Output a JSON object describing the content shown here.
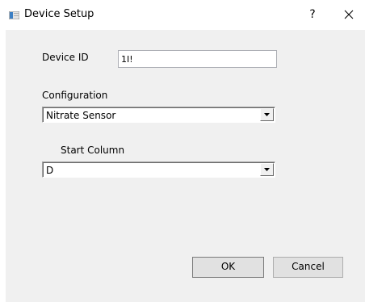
{
  "window": {
    "title": "Device Setup",
    "help_glyph": "?",
    "close_glyph": "×",
    "app_icon": "window-icon"
  },
  "form": {
    "device_id": {
      "label": "Device ID",
      "value": "1I!"
    },
    "configuration": {
      "label": "Configuration",
      "selected": "Nitrate Sensor"
    },
    "start_column": {
      "label": "Start Column",
      "selected": "D"
    }
  },
  "buttons": {
    "ok_label": "OK",
    "cancel_label": "Cancel"
  },
  "colors": {
    "client_background": "#f0f0f0",
    "icon_blue": "#3c7fc4",
    "button_face": "#e1e1e1"
  }
}
